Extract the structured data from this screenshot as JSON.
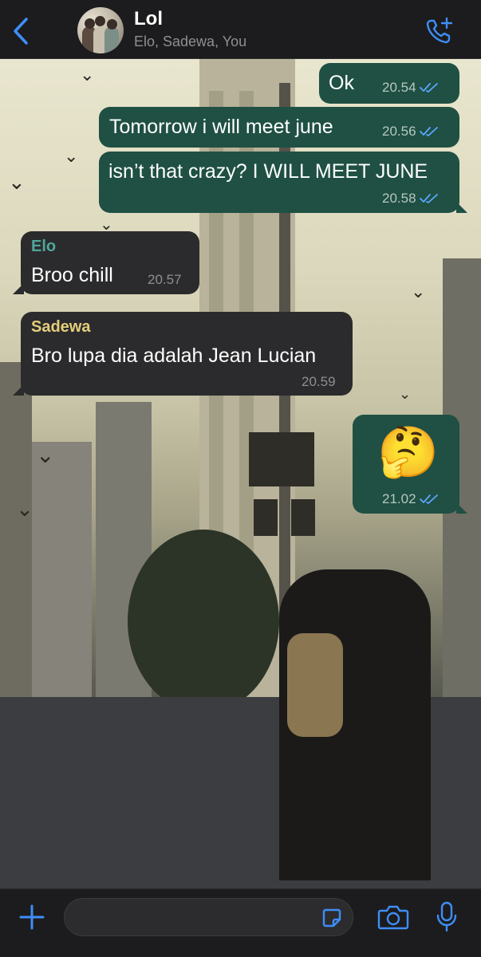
{
  "header": {
    "title": "Lol",
    "subtitle": "Elo, Sadewa, You",
    "back_icon": "chevron-left-icon",
    "call_icon": "add-call-icon"
  },
  "messages": [
    {
      "direction": "outgoing",
      "text": "Ok",
      "time": "20.54",
      "status": "read"
    },
    {
      "direction": "outgoing",
      "text": "Tomorrow i will meet june",
      "time": "20.56",
      "status": "read"
    },
    {
      "direction": "outgoing",
      "text": "isn’t that crazy? I WILL MEET JUNE",
      "time": "20.58",
      "status": "read"
    },
    {
      "direction": "incoming",
      "sender": "Elo",
      "text": "Broo chill",
      "time": "20.57"
    },
    {
      "direction": "incoming",
      "sender": "Sadewa",
      "text": "Bro lupa dia adalah Jean Lucian",
      "time": "20.59"
    },
    {
      "direction": "outgoing",
      "text": "🤔",
      "time": "21.02",
      "status": "read"
    }
  ],
  "composer": {
    "value": "",
    "plus_icon": "plus-icon",
    "sticker_icon": "sticker-icon",
    "camera_icon": "camera-icon",
    "mic_icon": "microphone-icon"
  },
  "colors": {
    "accent": "#3e8ef7",
    "outgoing_bubble": "#1f5043",
    "incoming_bubble": "#2b2b2d",
    "sender_elo": "#4fa79a",
    "sender_sadewa": "#e3cf7a",
    "read_ticks": "#5aa7ff"
  }
}
